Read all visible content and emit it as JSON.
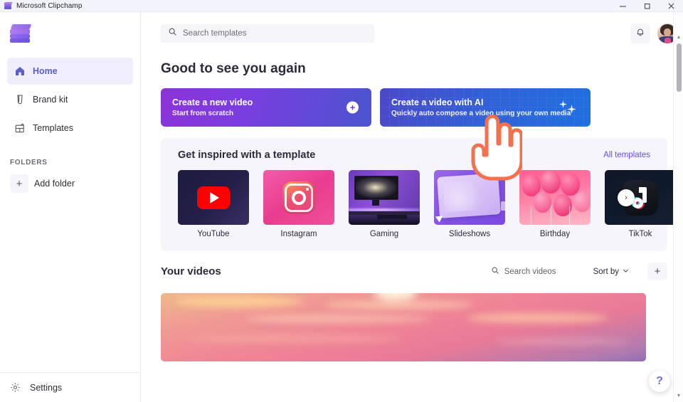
{
  "window": {
    "title": "Microsoft Clipchamp",
    "app_icon": "clipchamp-icon",
    "controls": {
      "minimize": "minimize",
      "maximize": "restore",
      "close": "close"
    }
  },
  "sidebar": {
    "logo": "clipchamp-logo",
    "items": [
      {
        "label": "Home",
        "icon": "home-icon",
        "active": true
      },
      {
        "label": "Brand kit",
        "icon": "brand-kit-icon",
        "active": false
      },
      {
        "label": "Templates",
        "icon": "templates-icon",
        "active": false
      }
    ],
    "folders_header": "FOLDERS",
    "add_folder": {
      "label": "Add folder",
      "icon": "plus-icon"
    },
    "settings": {
      "label": "Settings",
      "icon": "gear-icon"
    }
  },
  "topbar": {
    "search": {
      "placeholder": "Search templates",
      "icon": "search-icon",
      "value": ""
    },
    "notifications": "bell-icon",
    "avatar": "user-avatar"
  },
  "main": {
    "greeting": "Good to see you again",
    "heroes": [
      {
        "title": "Create a new video",
        "subtitle": "Start from scratch",
        "icon": "plus-circle-icon",
        "accent": "#7a3de0"
      },
      {
        "title": "Create a video with AI",
        "subtitle": "Quickly auto compose a video using your own media",
        "icon": "sparkles-icon",
        "accent": "#2f63d8"
      }
    ],
    "templates_section": {
      "title": "Get inspired with a template",
      "all_link": "All templates",
      "next_button": "chevron-right-icon",
      "items": [
        {
          "label": "YouTube",
          "thumb": "youtube-thumbnail"
        },
        {
          "label": "Instagram",
          "thumb": "instagram-thumbnail"
        },
        {
          "label": "Gaming",
          "thumb": "gaming-thumbnail"
        },
        {
          "label": "Slideshows",
          "thumb": "slideshows-thumbnail"
        },
        {
          "label": "Birthday",
          "thumb": "birthday-thumbnail"
        },
        {
          "label": "TikTok",
          "thumb": "tiktok-thumbnail"
        }
      ]
    },
    "your_videos": {
      "title": "Your videos",
      "search": {
        "placeholder": "Search videos",
        "icon": "search-icon",
        "value": ""
      },
      "sort_by": {
        "label": "Sort by",
        "icon": "chevron-down-icon"
      },
      "add_button": "plus-icon",
      "video_thumbnail": "sunset-sky-video"
    }
  },
  "overlay": {
    "cursor": "pointing-hand-cursor",
    "help_button": {
      "label": "?",
      "name": "help-icon"
    }
  },
  "scrollbar": {
    "up": "scroll-up-arrow",
    "down": "scroll-down-arrow",
    "thumb": "scroll-thumb"
  },
  "colors": {
    "accent": "#5b5fc7",
    "link": "#6a4ce8",
    "panel": "#f6f5fb",
    "hero_new": "#7a3de0",
    "hero_ai": "#2f63d8"
  }
}
